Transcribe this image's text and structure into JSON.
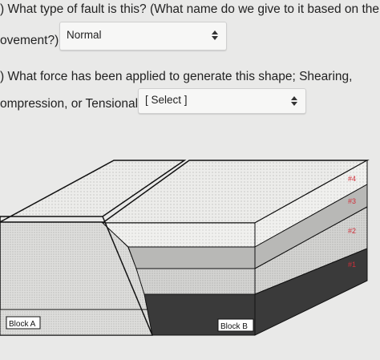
{
  "questions": [
    {
      "line1": ") What type of fault is this? (What name do we give to it based on the",
      "line2": "ovement?)",
      "select_value": "Normal"
    },
    {
      "line1": ") What force has been applied to generate this shape; Shearing,",
      "line2": "ompression, or Tensional?",
      "select_value": "[ Select ]"
    }
  ],
  "diagram": {
    "block_a_label": "Block A",
    "block_b_label": "Block B",
    "layer_labels": [
      "#4",
      "#3",
      "#2",
      "#1"
    ],
    "colors": {
      "layer4": "#ececea",
      "layer3": "#b8b8b6",
      "layer2": "#dededc",
      "layer1": "#3a3a3a",
      "label_color": "#d0303a"
    }
  }
}
